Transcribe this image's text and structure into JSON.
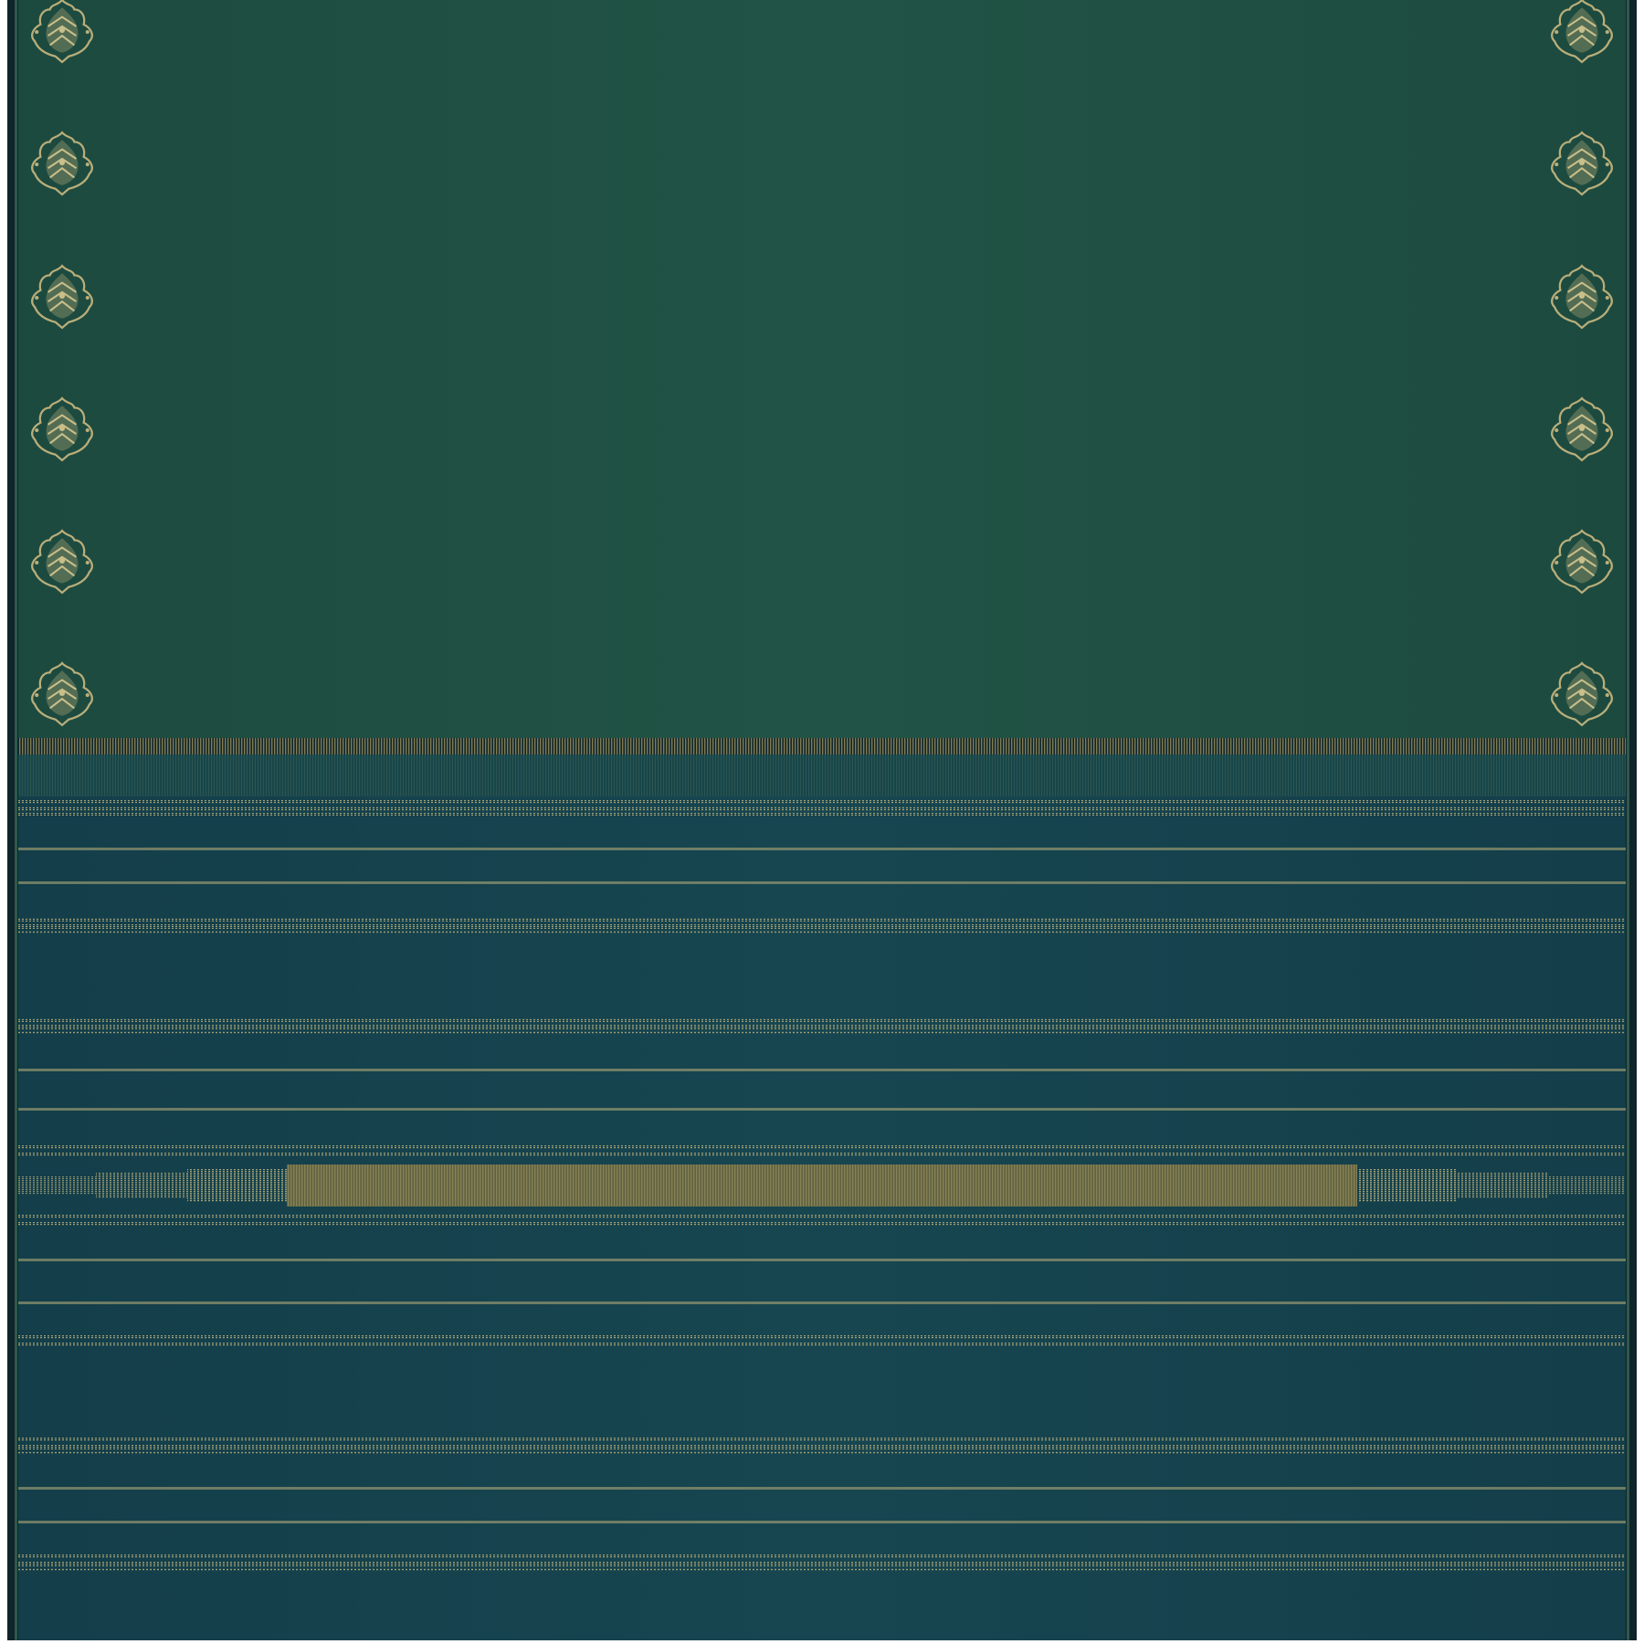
{
  "colors": {
    "body_green": "#1d4a3f",
    "body_green_light": "#215446",
    "pallu_teal": "#133e4a",
    "pallu_teal_light": "#174650",
    "edge_dark": "#10252b",
    "zari_gold": "#b9ae7a",
    "zari_gold_dark": "#8c8558",
    "background": "#ffffff"
  },
  "motifs": {
    "type": "paisley-buta",
    "rows": 6,
    "columns": [
      "left",
      "right"
    ],
    "count": 12
  },
  "stripes": {
    "style": "zari-pinstripe",
    "count": 20
  }
}
